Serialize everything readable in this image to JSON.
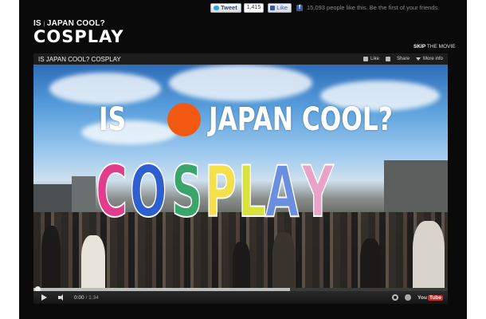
{
  "social": {
    "tweet_label": "Tweet",
    "tweet_count": "1,415",
    "like_label": "Like",
    "like_text": "15,093 people like this. Be the first of your friends."
  },
  "site_logo": {
    "line1_left": "IS",
    "line1_right": "JAPAN COOL?",
    "line2": "COSPLAY"
  },
  "skip": {
    "bold": "SKIP",
    "rest": "THE MOVIE"
  },
  "player": {
    "title": "IS JAPAN COOL? COSPLAY",
    "actions": {
      "like": "Like",
      "share": "Share",
      "more_info": "More info"
    },
    "hero": {
      "line1_left": "IS",
      "line1_right": "JAPAN COOL?",
      "letters": [
        "C",
        "O",
        "S",
        "P",
        "L",
        "A",
        "Y"
      ]
    },
    "current_time": "0:00",
    "duration": "1:34",
    "progress_fraction": 0.62,
    "youtube_you": "You",
    "youtube_tube": "Tube"
  },
  "colors": {
    "accent_orange": "#f25a14",
    "letter_fills": [
      "#e23c8d",
      "#2e5fd0",
      "#3aa56b",
      "#f4e04a",
      "#d9e23a",
      "#6a8fe0",
      "#e8a4c8"
    ]
  }
}
